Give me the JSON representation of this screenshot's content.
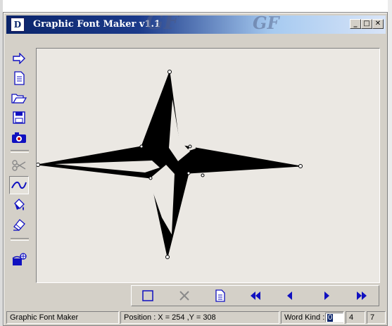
{
  "window": {
    "title": "Graphic Font Maker v1.1",
    "app_icon_glyph": "D",
    "logo_left": "GF",
    "logo_right": "GF",
    "caption_minimize": "_",
    "caption_maximize": "□",
    "caption_close": "✕"
  },
  "toolbar": {
    "tools": [
      {
        "id": "next",
        "icon": "arrow-right-icon"
      },
      {
        "id": "new",
        "icon": "new-document-icon"
      },
      {
        "id": "open",
        "icon": "open-folder-icon"
      },
      {
        "id": "save",
        "icon": "floppy-disk-icon"
      },
      {
        "id": "capture",
        "icon": "camera-icon"
      },
      {
        "id": "cut",
        "icon": "scissors-icon",
        "disabled": true
      },
      {
        "id": "curve",
        "icon": "curve-icon",
        "active": true
      },
      {
        "id": "fill",
        "icon": "paint-bucket-icon"
      },
      {
        "id": "erase",
        "icon": "eraser-icon"
      },
      {
        "id": "settings",
        "icon": "paint-can-icon"
      }
    ]
  },
  "navigator": {
    "buttons": [
      "select-box-icon",
      "delete-icon",
      "page-icon",
      "first-icon",
      "previous-icon",
      "next-icon",
      "last-icon"
    ]
  },
  "status": {
    "app_name": "Graphic Font Maker",
    "position": "Position : X = 254 ,Y = 308",
    "word_kind_label": "Word Kind :",
    "word_kind_value": "0",
    "field2": "4",
    "field3": "7"
  },
  "colors": {
    "title_start": "#0a246a",
    "title_end": "#a6caf0",
    "face": "#d4d0c8",
    "icon_blue": "#1010c0"
  }
}
